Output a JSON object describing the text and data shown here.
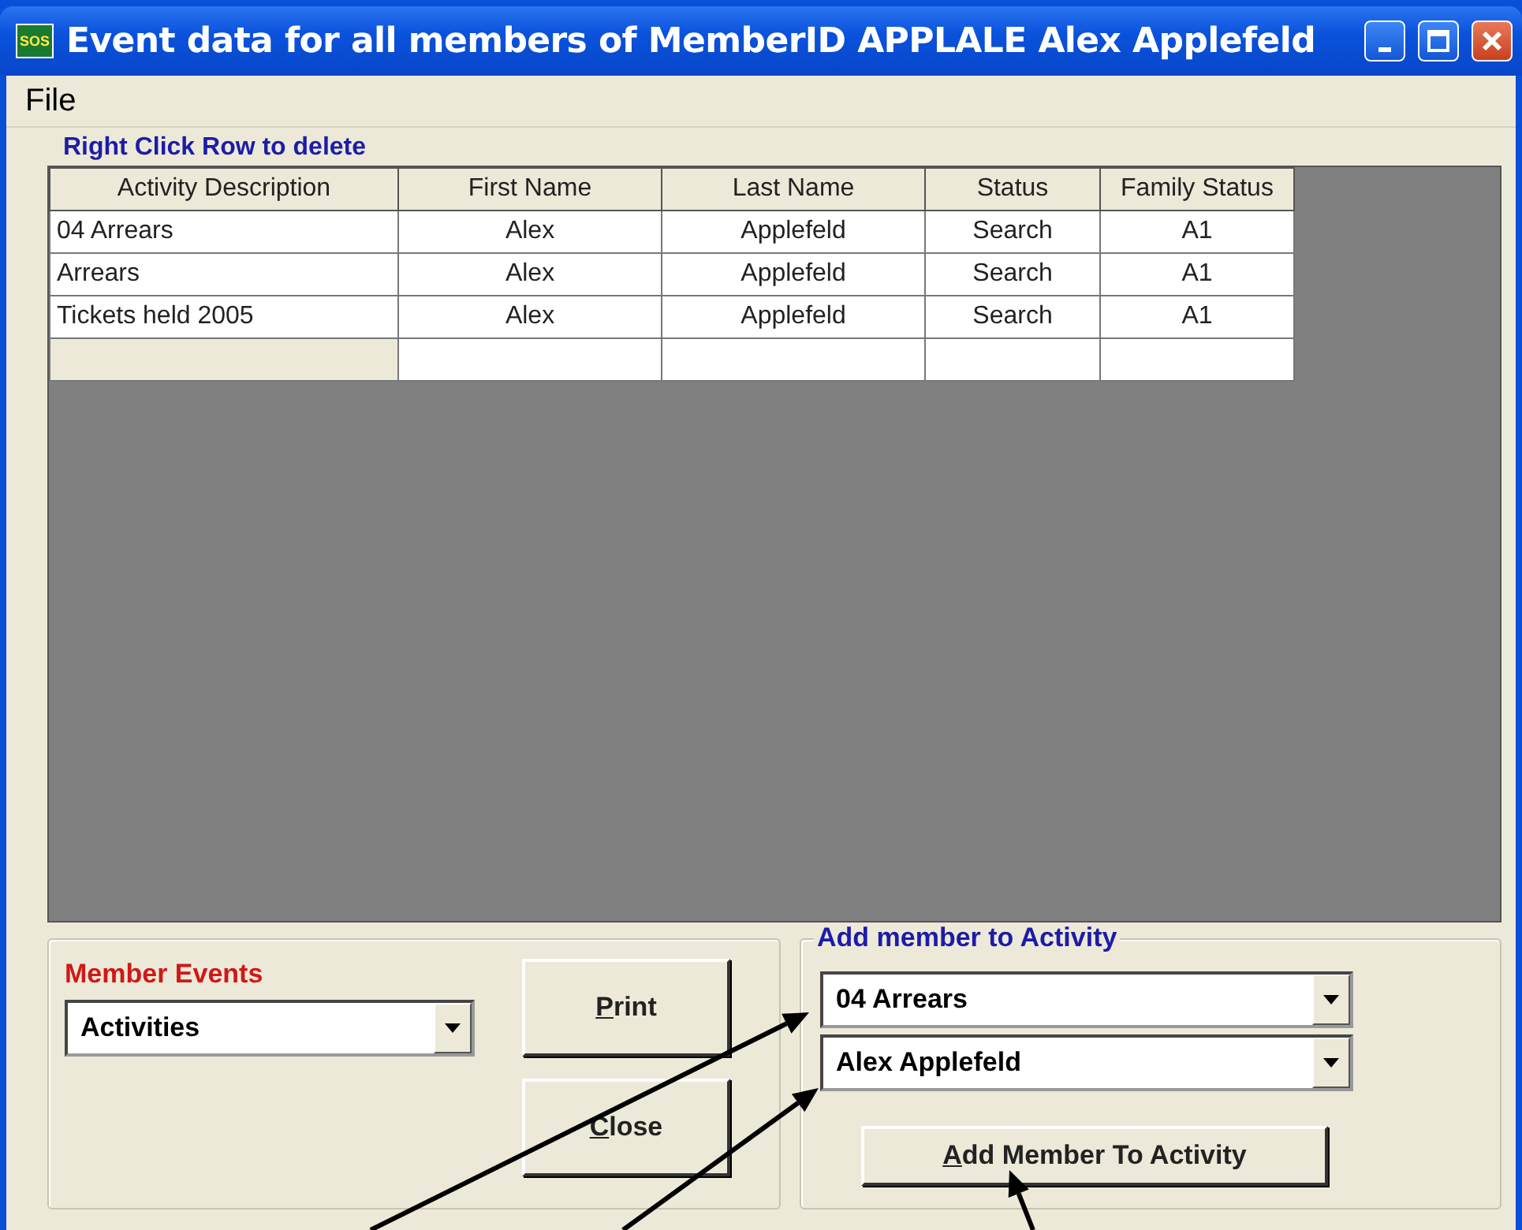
{
  "window": {
    "title": "Event data for all members of MemberID APPLALE Alex Applefeld",
    "icon_text": "SOS"
  },
  "menu": [
    "File"
  ],
  "grid": {
    "caption": "Right Click Row to delete",
    "columns": [
      "Activity Description",
      "First Name",
      "Last Name",
      "Status",
      "Family Status"
    ],
    "rows": [
      {
        "cells": [
          "04 Arrears",
          "Alex",
          "Applefeld",
          "Search",
          "A1"
        ]
      },
      {
        "cells": [
          "Arrears",
          "Alex",
          "Applefeld",
          "Search",
          "A1"
        ]
      },
      {
        "cells": [
          "Tickets held 2005",
          "Alex",
          "Applefeld",
          "Search",
          "A1"
        ]
      }
    ]
  },
  "member_events": {
    "label": "Member Events",
    "value": "Activities"
  },
  "buttons": [
    "Print",
    "Close"
  ],
  "add_group": {
    "title": "Add member to Activity",
    "activity": "04 Arrears",
    "member": "Alex Applefeld",
    "button": "Add Member To Activity"
  }
}
